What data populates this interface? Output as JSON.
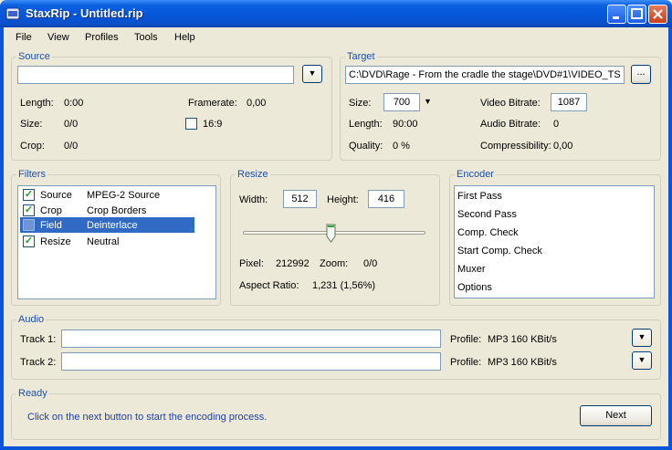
{
  "window": {
    "title": "StaxRip - Untitled.rip"
  },
  "menu": [
    "File",
    "View",
    "Profiles",
    "Tools",
    "Help"
  ],
  "source": {
    "title": "Source",
    "path": "",
    "length_label": "Length:",
    "length": "0:00",
    "size_label": "Size:",
    "size": "0/0",
    "crop_label": "Crop:",
    "crop": "0/0",
    "framerate_label": "Framerate:",
    "framerate": "0,00",
    "ratio_label": "16:9"
  },
  "target": {
    "title": "Target",
    "path": "C:\\DVD\\Rage - From the cradle the stage\\DVD#1\\VIDEO_TS",
    "browse_label": "...",
    "size_label": "Size:",
    "size": "700",
    "length_label": "Length:",
    "length": "90:00",
    "quality_label": "Quality:",
    "quality": "0 %",
    "video_bitrate_label": "Video Bitrate:",
    "video_bitrate": "1087",
    "audio_bitrate_label": "Audio Bitrate:",
    "audio_bitrate": "0",
    "compressibility_label": "Compressibility:",
    "compressibility": "0,00"
  },
  "filters": {
    "title": "Filters",
    "items": [
      {
        "name": "Source",
        "value": "MPEG-2 Source",
        "checked": true
      },
      {
        "name": "Crop",
        "value": "Crop Borders",
        "checked": true
      },
      {
        "name": "Field",
        "value": "Deinterlace",
        "checked": false
      },
      {
        "name": "Resize",
        "value": "Neutral",
        "checked": true
      }
    ]
  },
  "resize": {
    "title": "Resize",
    "width_label": "Width:",
    "width": "512",
    "height_label": "Height:",
    "height": "416",
    "slider_level": 0.48,
    "pixel_label": "Pixel:",
    "pixel": "212992",
    "zoom_label": "Zoom:",
    "zoom": "0/0",
    "aspect_label": "Aspect Ratio:",
    "aspect": "1,231 (1,56%)"
  },
  "encoder": {
    "title": "Encoder",
    "items": [
      "First Pass",
      "Second Pass",
      "Comp. Check",
      "Start Comp. Check",
      "Muxer",
      "Options"
    ]
  },
  "audio": {
    "title": "Audio",
    "track1_label": "Track 1:",
    "track1": "",
    "profile1_label": "Profile:",
    "profile1": "MP3 160 KBit/s",
    "track2_label": "Track 2:",
    "track2": "",
    "profile2_label": "Profile:",
    "profile2": "MP3 160 KBit/s"
  },
  "status": {
    "title": "Ready",
    "message": "Click on the next button to start the encoding process.",
    "next_label": "Next"
  }
}
